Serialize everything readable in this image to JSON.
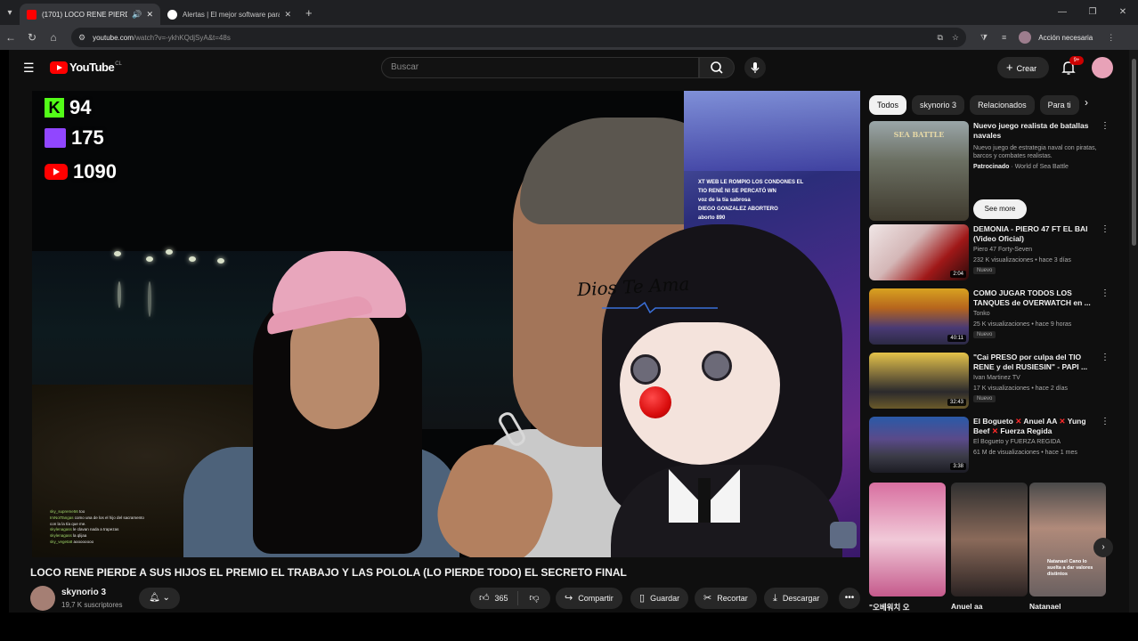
{
  "browser": {
    "tabs": [
      {
        "title": "(1701) LOCO RENE PIERDI",
        "active": true
      },
      {
        "title": "Alertas | El mejor software para",
        "active": false
      }
    ],
    "url_host": "youtube.com",
    "url_path": "/watch?v=-ykhKQdjSyA&t=48s",
    "profile_action": "Acción necesaria"
  },
  "header": {
    "logo_text": "YouTube",
    "logo_country": "CL",
    "search_placeholder": "Buscar",
    "create_label": "Crear",
    "notif_badge": "9+"
  },
  "video": {
    "stats": {
      "kick": "94",
      "twitch": "175",
      "youtube": "1090"
    },
    "overlay_text": "Dios Te Ama",
    "chat_overlay": [
      {
        "name": "",
        "text": "XT WEB LE ROMPIO LOS CONDONES EL"
      },
      {
        "name": "",
        "text": "TIO RENÉ NI SE PERCATÓ WN"
      },
      {
        "name": "",
        "text": "voz de la tía sabrosa"
      },
      {
        "name": "",
        "text": "DIEGO GONZALEZ ABORTERO"
      },
      {
        "name": "",
        "text": "aborto 890"
      }
    ],
    "chat_log": [
      {
        "name": "sky_supreme56",
        "text": "too"
      },
      {
        "name": "ImNotTangas",
        "text": "como una de los el hijo del sacramento"
      },
      {
        "name": "",
        "text": "con la la tía que me."
      },
      {
        "name": "skylenagass",
        "text": "le clavan nada a trapezas"
      },
      {
        "name": "skylenagass",
        "text": "la qlijaa"
      },
      {
        "name": "sky_vegeta8",
        "text": "aoooooooo"
      }
    ]
  },
  "below": {
    "title": "LOCO RENE PIERDE A SUS HIJOS EL PREMIO EL TRABAJO Y LAS POLOLA (LO PIERDE TODO) EL SECRETO FINAL",
    "channel": "skynorio 3",
    "subs": "19,7 K suscriptores",
    "likes": "365",
    "share": "Compartir",
    "save": "Guardar",
    "clip": "Recortar",
    "download": "Descargar"
  },
  "sidebar": {
    "chips": [
      "Todos",
      "skynorio 3",
      "Relacionados",
      "Para ti"
    ],
    "ad": {
      "thumb_text": "SEA BATTLE",
      "title": "Nuevo juego realista de batallas navales",
      "desc": "Nuevo juego de estrategia naval con piratas, barcos y combates realistas.",
      "sponsored": "Patrocinado",
      "advertiser": "World of Sea Battle",
      "cta": "See more"
    },
    "recs": [
      {
        "title": "DEMONIA - PIERO 47 FT EL BAI (Video Oficial)",
        "channel": "Piero 47 Forty-Seven",
        "meta": "232 K visualizaciones • hace 3 días",
        "badge": "Nuevo",
        "duration": "2:04"
      },
      {
        "title": "COMO JUGAR TODOS LOS TANQUES de OVERWATCH en ...",
        "channel": "Tonko",
        "meta": "25 K visualizaciones • hace 9 horas",
        "badge": "Nuevo",
        "duration": "40:11"
      },
      {
        "title": "\"Cai PRESO por culpa del TIO RENE y del RUSIESIN\" - PAPI ...",
        "channel": "Ivan Martinez TV",
        "meta": "17 K visualizaciones • hace 2 días",
        "badge": "Nuevo",
        "duration": "32:43"
      },
      {
        "title_parts": [
          "El Bogueto",
          "Anuel AA",
          "Yung Beef",
          "Fuerza Regida"
        ],
        "channel": "El Bogueto y FUERZA REGIDA",
        "meta": "61 M de visualizaciones • hace 1 mes",
        "duration": "3:38"
      }
    ],
    "shorts": [
      "\"오베워치 오",
      "Anuel aa",
      "Natanael"
    ],
    "short_caption": "Natanael Cano lo suelta a dar valores distintos"
  },
  "colors": {
    "yt_red": "#ff0000",
    "bg": "#0f0f0f",
    "chip": "#272727"
  }
}
